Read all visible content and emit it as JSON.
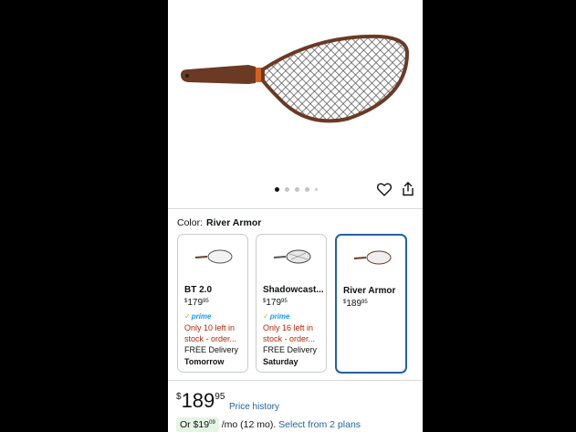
{
  "product": {
    "dots": {
      "count": 5,
      "active_index": 0
    },
    "color": {
      "label": "Color:",
      "value": "River Armor"
    },
    "variants": [
      {
        "name": "BT 2.0",
        "currency": "$",
        "price_whole": "179",
        "price_frac": "95",
        "prime_label": "prime",
        "stock": "Only 10 left in stock - order...",
        "delivery": "FREE Delivery",
        "delivery_day": "Tomorrow",
        "selected": false
      },
      {
        "name": "Shadowcast...",
        "currency": "$",
        "price_whole": "179",
        "price_frac": "95",
        "prime_label": "prime",
        "stock": "Only 16 left in stock - order...",
        "delivery": "FREE Delivery",
        "delivery_day": "Saturday",
        "selected": false
      },
      {
        "name": "River Armor",
        "currency": "$",
        "price_whole": "189",
        "price_frac": "95",
        "selected": true
      }
    ],
    "price": {
      "currency": "$",
      "whole": "189",
      "fraction": "95"
    },
    "price_history_label": "Price history",
    "monthly": {
      "prefix": "Or $",
      "whole": "19",
      "fraction": "09",
      "suffix": "/mo (12 mo).",
      "link": "Select from 2 plans"
    }
  },
  "icons": {
    "favorite": "heart-icon",
    "share": "share-icon"
  },
  "colors": {
    "selected_border": "#2162a1",
    "stock_red": "#b12704",
    "prime_blue": "#1a98ff",
    "link_blue": "#2162a1"
  }
}
